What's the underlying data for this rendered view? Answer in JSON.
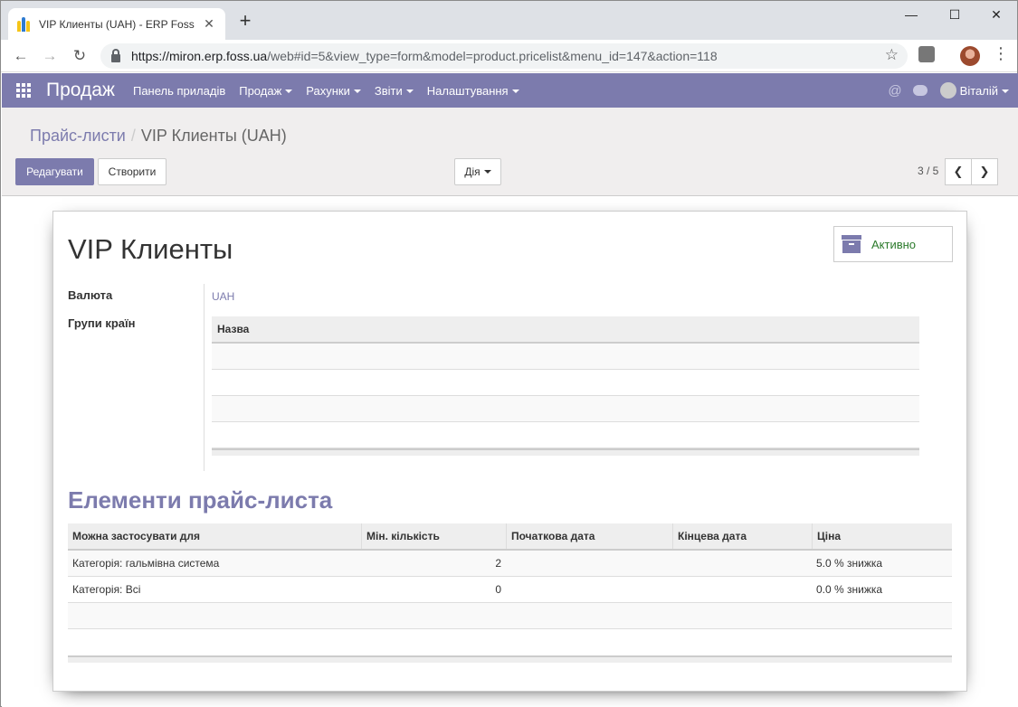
{
  "browser": {
    "tab_title": "VIP Клиенты (UAH) - ERP Foss",
    "url_host": "https://miron.erp.foss.ua",
    "url_path": "/web#id=5&view_type=form&model=product.pricelist&menu_id=147&action=118"
  },
  "nav": {
    "brand": "Продаж",
    "menu": [
      "Панель приладів",
      "Продаж",
      "Рахунки",
      "Звіти",
      "Налаштування"
    ],
    "user": "Віталій"
  },
  "breadcrumb": {
    "parent": "Прайс-листи",
    "current": "VIP Клиенты (UAH)"
  },
  "buttons": {
    "edit": "Редагувати",
    "create": "Створити",
    "action": "Дія"
  },
  "pager": "3 / 5",
  "record": {
    "title": "VIP Клиенты",
    "active_label": "Активно",
    "currency_label": "Валюта",
    "currency_value": "UAH",
    "country_groups_label": "Групи країн",
    "country_table_header": "Назва"
  },
  "items": {
    "section_title": "Елементи прайс-листа",
    "columns": [
      "Можна застосувати для",
      "Мін. кількість",
      "Початкова дата",
      "Кінцева дата",
      "Ціна"
    ],
    "rows": [
      [
        "Категорія: гальмівна система",
        "2",
        "",
        "",
        "5.0 % знижка"
      ],
      [
        "Категорія: Всі",
        "0",
        "",
        "",
        "0.0 % знижка"
      ]
    ]
  },
  "colors": {
    "brand": "#7c7bad",
    "active": "#2b7a2b"
  }
}
